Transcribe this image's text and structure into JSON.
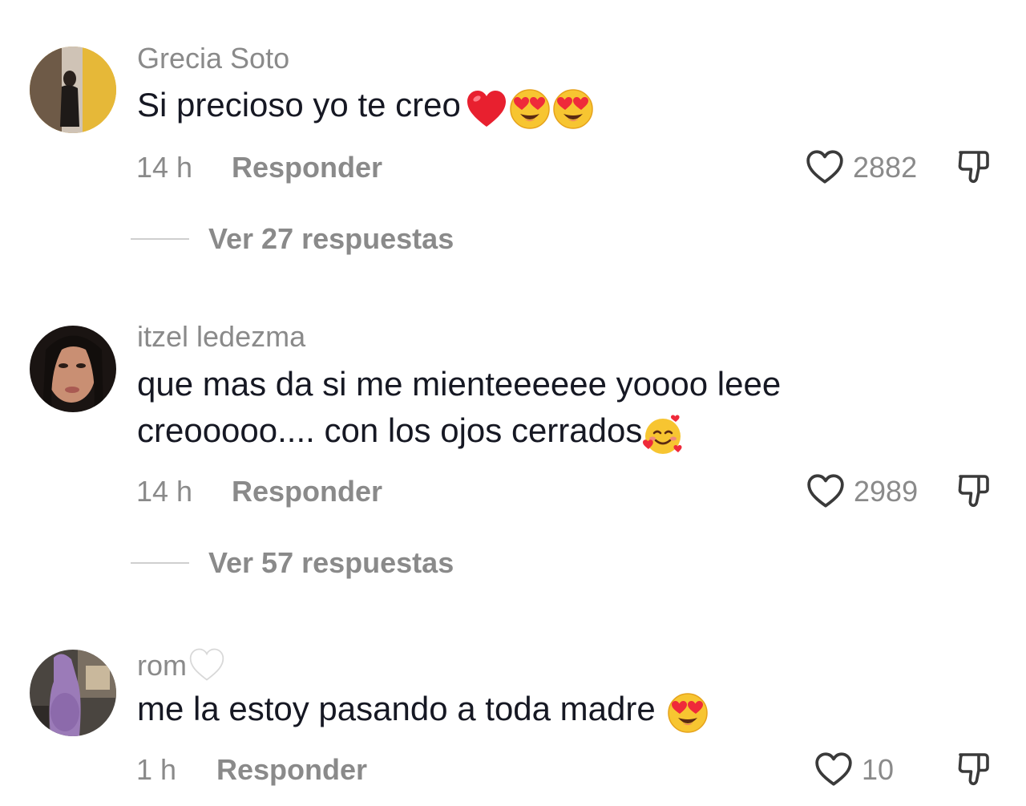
{
  "comments": [
    {
      "username": "Grecia Soto",
      "text": "Si precioso yo te creo",
      "time": "14 h",
      "reply_label": "Responder",
      "likes": "2882",
      "replies_label": "Ver 27 respuestas"
    },
    {
      "username": "itzel ledezma",
      "text_line1": "que mas da si me mienteeeeee yoooo leee",
      "text_line2": "creooooo.... con los ojos cerrados",
      "time": "14 h",
      "reply_label": "Responder",
      "likes": "2989",
      "replies_label": "Ver 57 respuestas"
    },
    {
      "username": "rom",
      "text": "me la estoy pasando a toda madre",
      "time": "1 h",
      "reply_label": "Responder",
      "likes": "10"
    }
  ],
  "icons": {
    "like": "heart-outline-icon",
    "dislike": "thumbs-down-icon",
    "heart_emoji": "red-heart-emoji",
    "heart_eyes_emoji": "heart-eyes-emoji",
    "hearts_face_emoji": "smiling-face-with-hearts-emoji",
    "white_heart_emoji": "white-heart-emoji"
  },
  "colors": {
    "text_primary": "#161823",
    "text_secondary": "#8a8a8a",
    "emoji_yellow": "#f7c531",
    "emoji_red": "#ef2a3a"
  }
}
